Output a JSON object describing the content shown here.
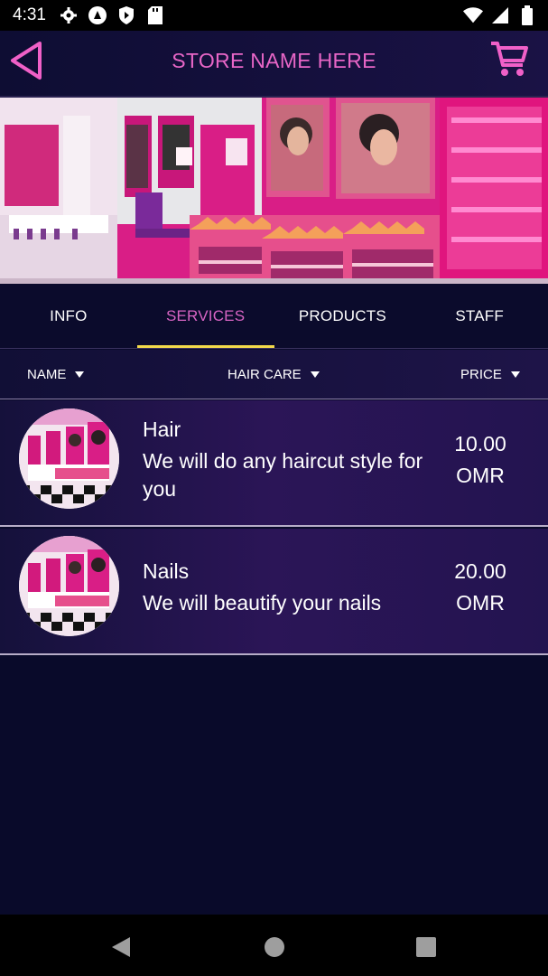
{
  "status_bar": {
    "time": "4:31",
    "left_icons": [
      "settings-icon",
      "app-a-icon",
      "shield-icon",
      "sd-card-icon"
    ],
    "right_icons": [
      "wifi-icon",
      "signal-icon",
      "battery-icon"
    ]
  },
  "header": {
    "title": "STORE NAME HERE",
    "back_icon": "back-triangle-icon",
    "cart_icon": "cart-icon",
    "accent_color": "#e866c7"
  },
  "tabs": [
    {
      "label": "INFO",
      "active": false
    },
    {
      "label": "SERVICES",
      "active": true
    },
    {
      "label": "PRODUCTS",
      "active": false
    },
    {
      "label": "STAFF",
      "active": false
    }
  ],
  "filters": {
    "name": "NAME",
    "category": "HAIR CARE",
    "price": "PRICE"
  },
  "services": [
    {
      "name": "Hair",
      "description": "We will do any haircut style for you",
      "price": "10.00",
      "currency": "OMR"
    },
    {
      "name": "Nails",
      "description": "We will beautify your nails",
      "price": "20.00",
      "currency": "OMR"
    }
  ],
  "colors": {
    "background": "#090a2a",
    "active_tab": "#d764c3",
    "tab_indicator": "#f1d94a"
  }
}
